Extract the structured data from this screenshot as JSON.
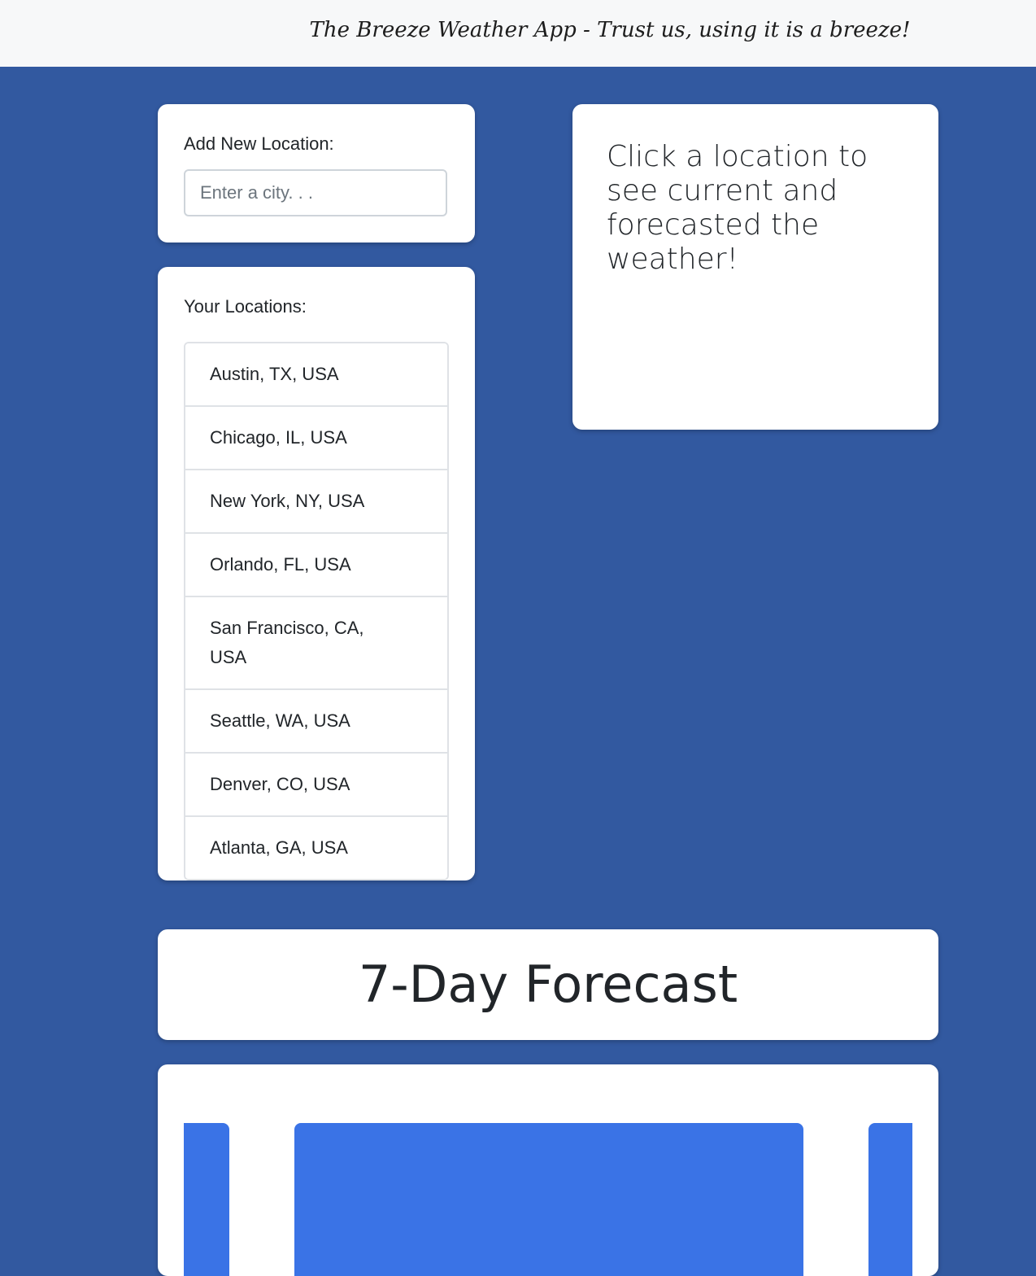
{
  "header": {
    "brand": "The Breeze Weather App - Trust us, using it is a breeze!"
  },
  "add_location": {
    "label": "Add New Location:",
    "input_placeholder": "Enter a city. . .",
    "input_value": ""
  },
  "locations": {
    "label": "Your Locations:",
    "items": [
      {
        "label": "Austin, TX, USA"
      },
      {
        "label": "Chicago, IL, USA"
      },
      {
        "label": "New York, NY, USA"
      },
      {
        "label": "Orlando, FL, USA"
      },
      {
        "label": "San Francisco, CA, USA"
      },
      {
        "label": "Seattle, WA, USA"
      },
      {
        "label": "Denver, CO, USA"
      },
      {
        "label": "Atlanta, GA, USA"
      }
    ]
  },
  "info": {
    "message": "Click a location to see current and forecasted the weather!"
  },
  "forecast": {
    "title": "7-Day Forecast"
  },
  "colors": {
    "background": "#3259a0",
    "navbar": "#f7f8f9",
    "tile": "#3a73e6"
  }
}
